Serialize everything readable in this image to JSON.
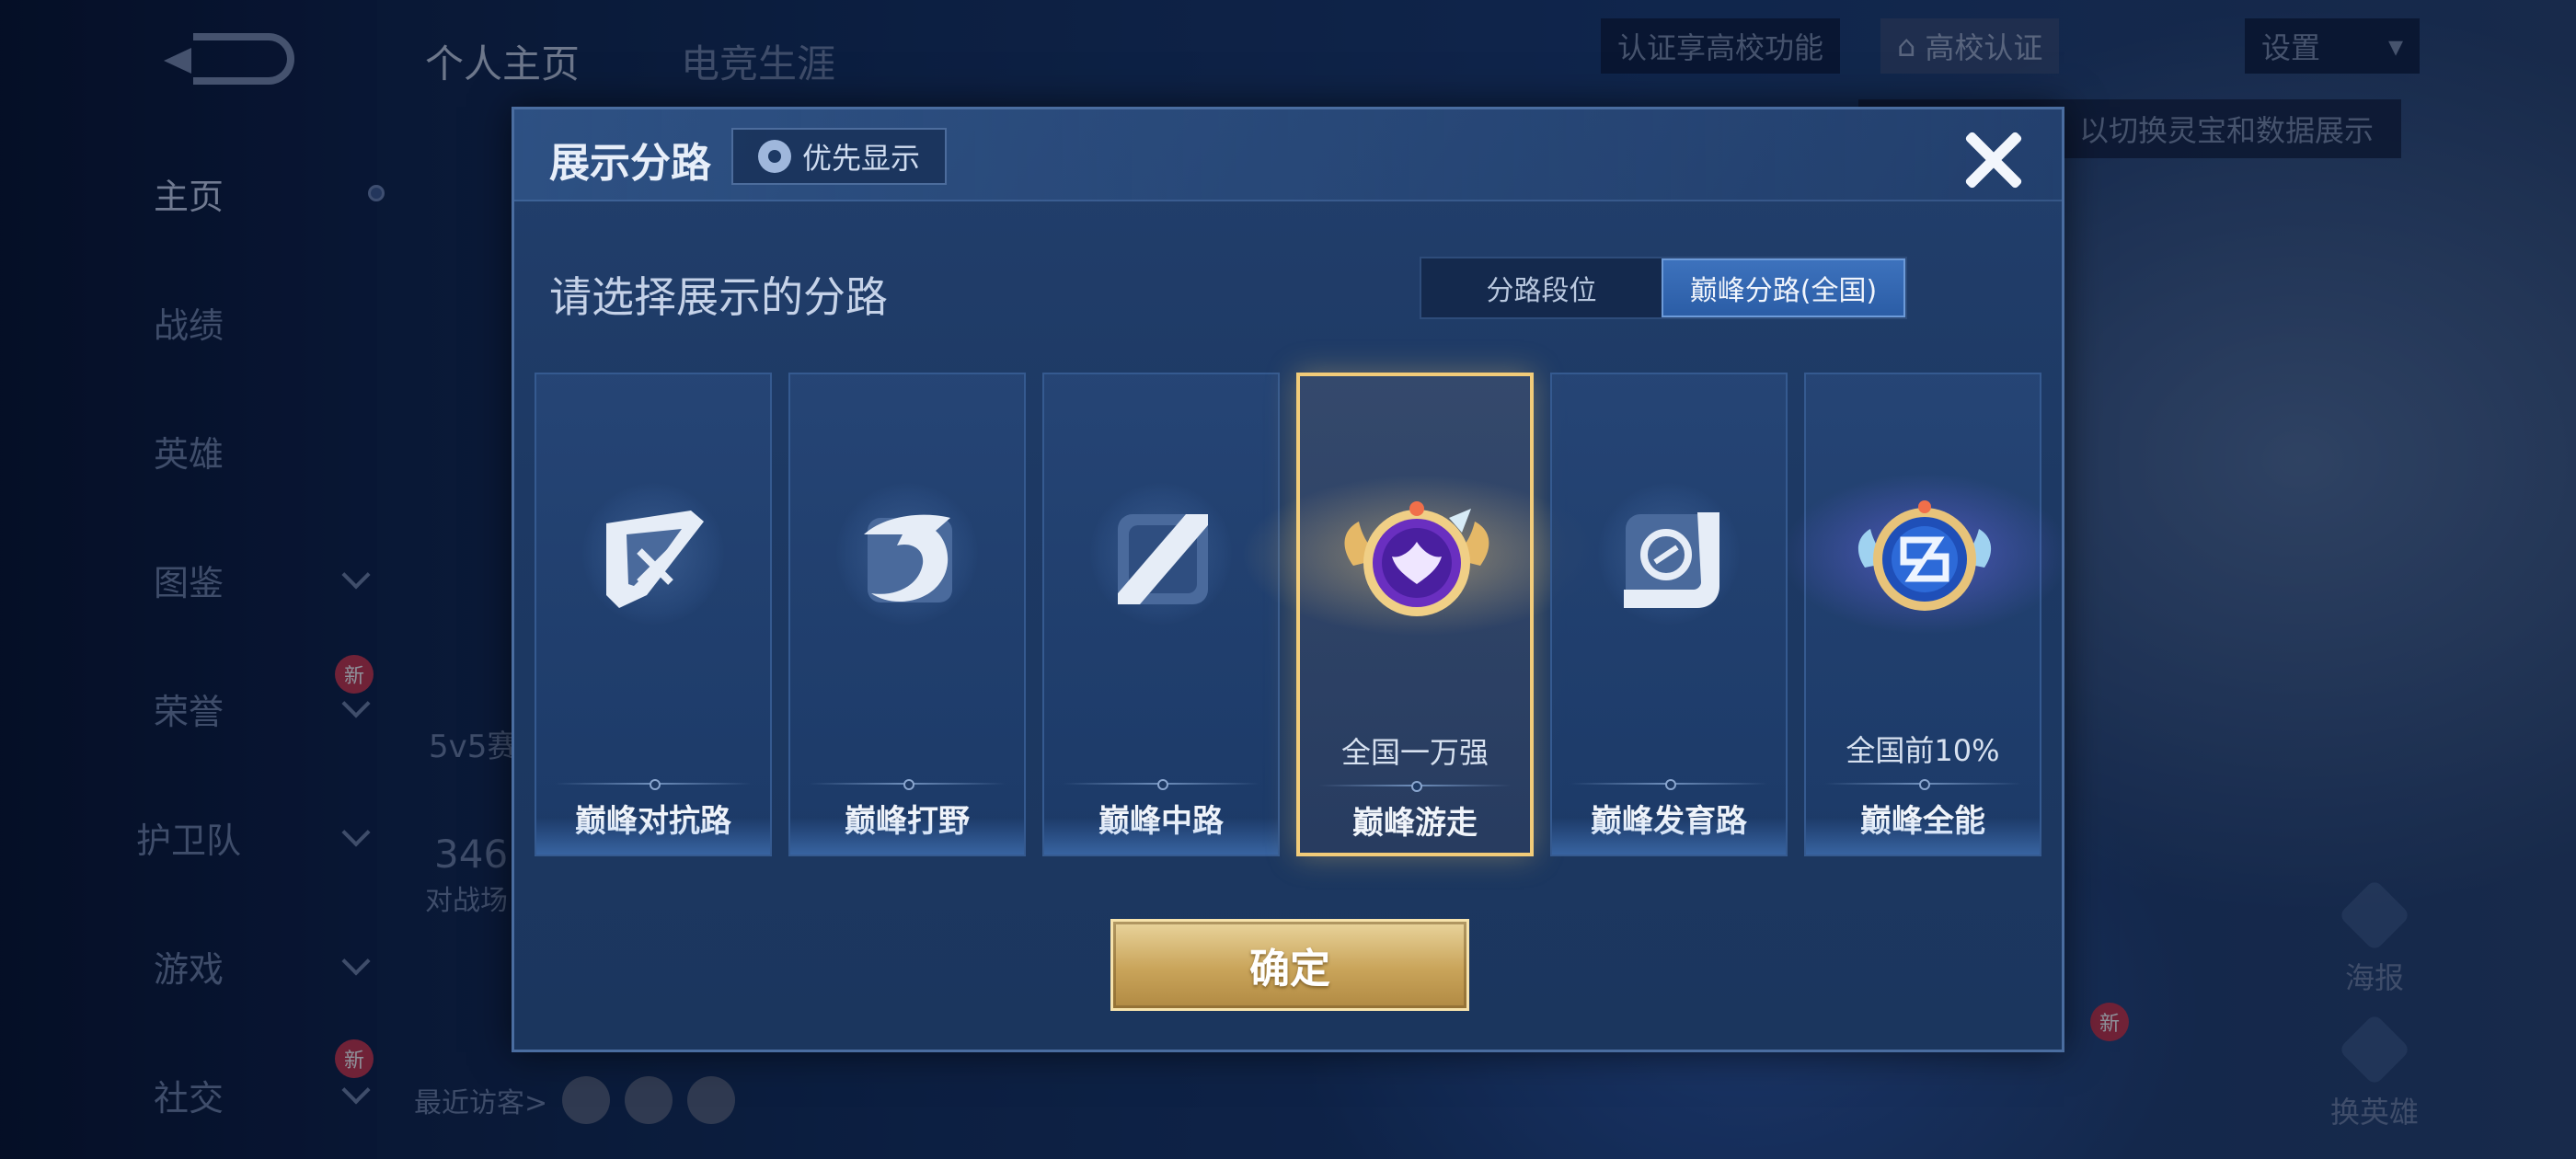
{
  "background": {
    "top_tabs": [
      "个人主页",
      "电竞生涯"
    ],
    "top_right": {
      "cert_text": "认证享高校功能",
      "college_cert": "高校认证",
      "settings": "设置"
    },
    "hint_strip": "以切换灵宝和数据展示",
    "nav": [
      {
        "label": "主页",
        "active": true,
        "chevron": false
      },
      {
        "label": "战绩",
        "active": false,
        "chevron": false
      },
      {
        "label": "英雄",
        "active": false,
        "chevron": false
      },
      {
        "label": "图鉴",
        "active": false,
        "chevron": true
      },
      {
        "label": "荣誉",
        "active": false,
        "chevron": true,
        "badge": "新"
      },
      {
        "label": "护卫队",
        "active": false,
        "chevron": true
      },
      {
        "label": "游戏",
        "active": false,
        "chevron": true
      },
      {
        "label": "社交",
        "active": false,
        "chevron": true,
        "badge": "新"
      }
    ],
    "stat_mode": "5v5赛",
    "stat_number": "346",
    "stat_caption": "对战场",
    "recent_visitors": "最近访客>",
    "side_tools": [
      "海报",
      "换英雄"
    ],
    "side_badge": "新"
  },
  "modal": {
    "title": "展示分路",
    "priority_button": "优先显示",
    "subtitle": "请选择展示的分路",
    "toggle": [
      {
        "label": "分路段位",
        "active": false
      },
      {
        "label": "巅峰分路(全国)",
        "active": true
      }
    ],
    "cards": [
      {
        "label": "巅峰对抗路",
        "rank": "",
        "selected": false,
        "icon": "sword-lane-icon"
      },
      {
        "label": "巅峰打野",
        "rank": "",
        "selected": false,
        "icon": "dragon-jungle-icon"
      },
      {
        "label": "巅峰中路",
        "rank": "",
        "selected": false,
        "icon": "mid-lane-icon"
      },
      {
        "label": "巅峰游走",
        "rank": "全国一万强",
        "selected": true,
        "icon": "winged-support-medal-icon"
      },
      {
        "label": "巅峰发育路",
        "rank": "",
        "selected": false,
        "icon": "marksman-lane-icon"
      },
      {
        "label": "巅峰全能",
        "rank": "全国前10%",
        "selected": false,
        "icon": "allround-medal-icon"
      }
    ],
    "confirm_button": "确定"
  },
  "colors": {
    "accent_gold": "#f2cc79",
    "active_blue": "#3d72bd",
    "modal_bg": "#1d3964"
  }
}
